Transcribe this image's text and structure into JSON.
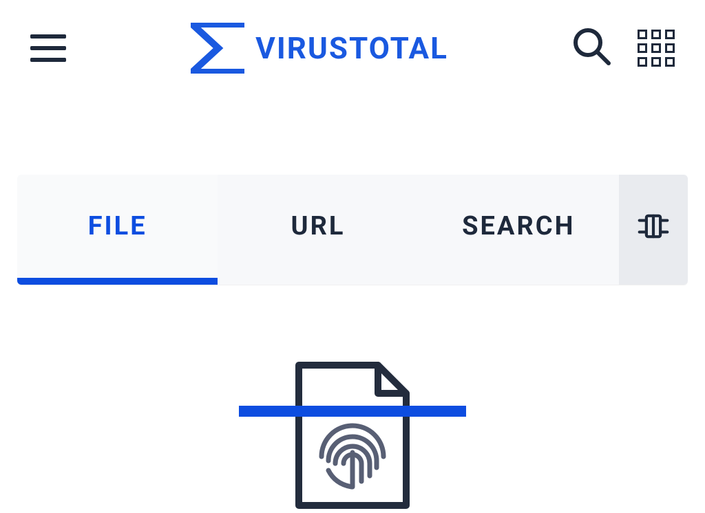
{
  "header": {
    "brand_label": "VIRUSTOTAL"
  },
  "tabs": {
    "file": "FILE",
    "url": "URL",
    "search": "SEARCH"
  }
}
